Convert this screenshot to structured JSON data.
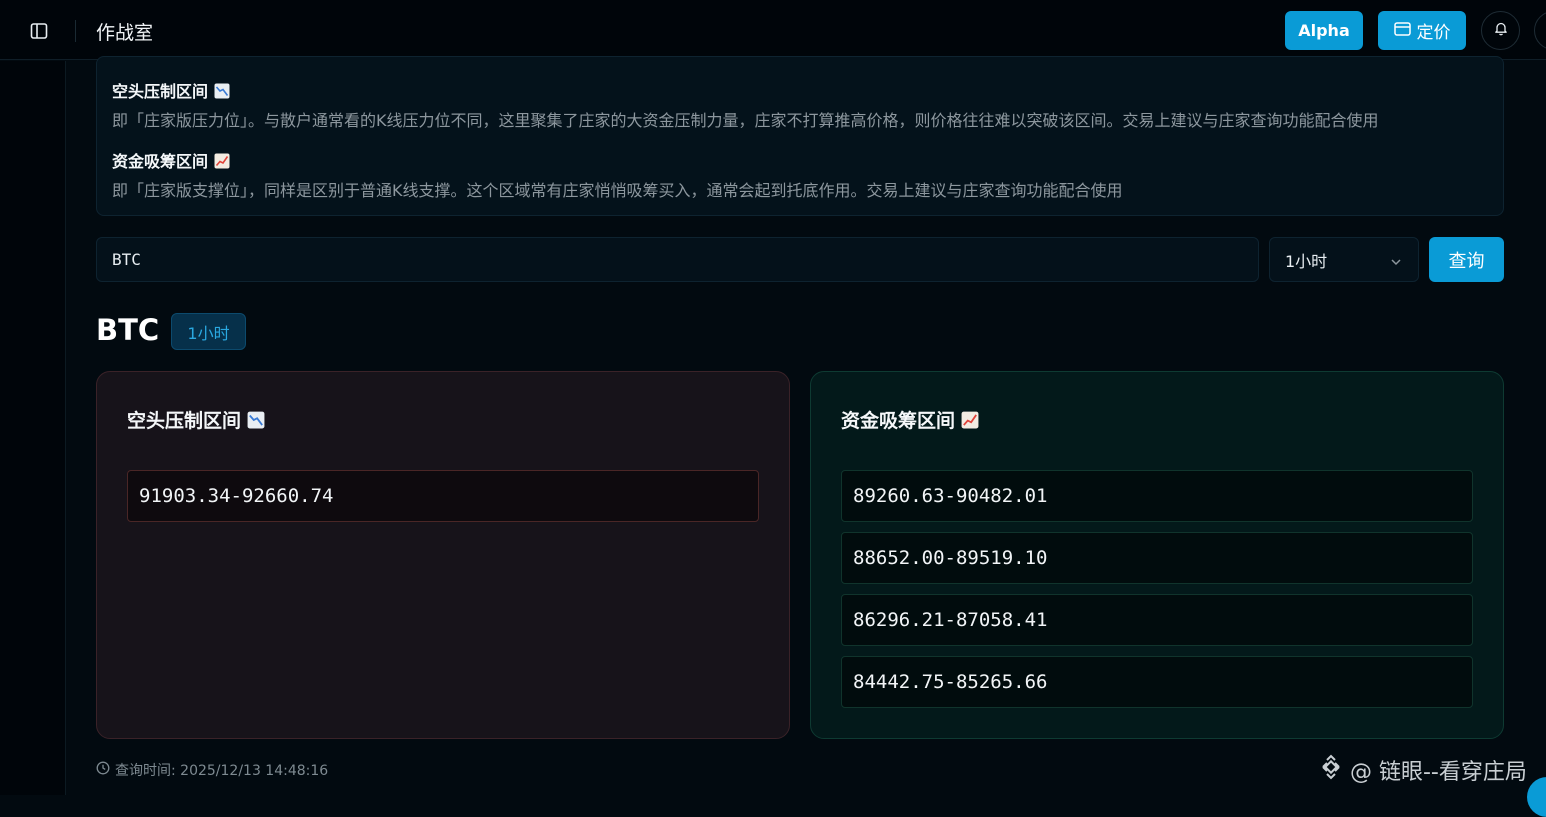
{
  "header": {
    "title": "作战室",
    "alpha_label": "Alpha",
    "pricing_label": "定价"
  },
  "info": {
    "short": {
      "heading": "空头压制区间",
      "description": "即「庄家版压力位」。与散户通常看的K线压力位不同，这里聚集了庄家的大资金压制力量，庄家不打算推高价格，则价格往往难以突破该区间。交易上建议与庄家查询功能配合使用"
    },
    "long": {
      "heading": "资金吸筹区间",
      "description": "即「庄家版支撑位」，同样是区别于普通K线支撑。这个区域常有庄家悄悄吸筹买入，通常会起到托底作用。交易上建议与庄家查询功能配合使用"
    }
  },
  "search": {
    "value": "BTC",
    "interval": "1小时",
    "query_label": "查询"
  },
  "result": {
    "symbol": "BTC",
    "interval_badge": "1小时",
    "short_panel": {
      "title": "空头压制区间",
      "ranges": [
        "91903.34-92660.74"
      ]
    },
    "long_panel": {
      "title": "资金吸筹区间",
      "ranges": [
        "89260.63-90482.01",
        "88652.00-89519.10",
        "86296.21-87058.41",
        "84442.75-85265.66"
      ]
    },
    "query_time": "查询时间: 2025/12/13 14:48:16"
  },
  "watermark": {
    "text": "@ 链眼--看穿庄局"
  },
  "colors": {
    "accent": "#0a9bd6",
    "short_panel_bg": "#17131a",
    "long_panel_bg": "#03191a"
  },
  "icons": {
    "sidebar_toggle": "sidebar-toggle-icon",
    "pricing": "card-icon",
    "bell": "bell-icon",
    "select_chevron": "chevron-down-icon",
    "short_emoji": "chart-decreasing-icon",
    "long_emoji": "chart-increasing-icon",
    "clock": "clock-icon"
  }
}
